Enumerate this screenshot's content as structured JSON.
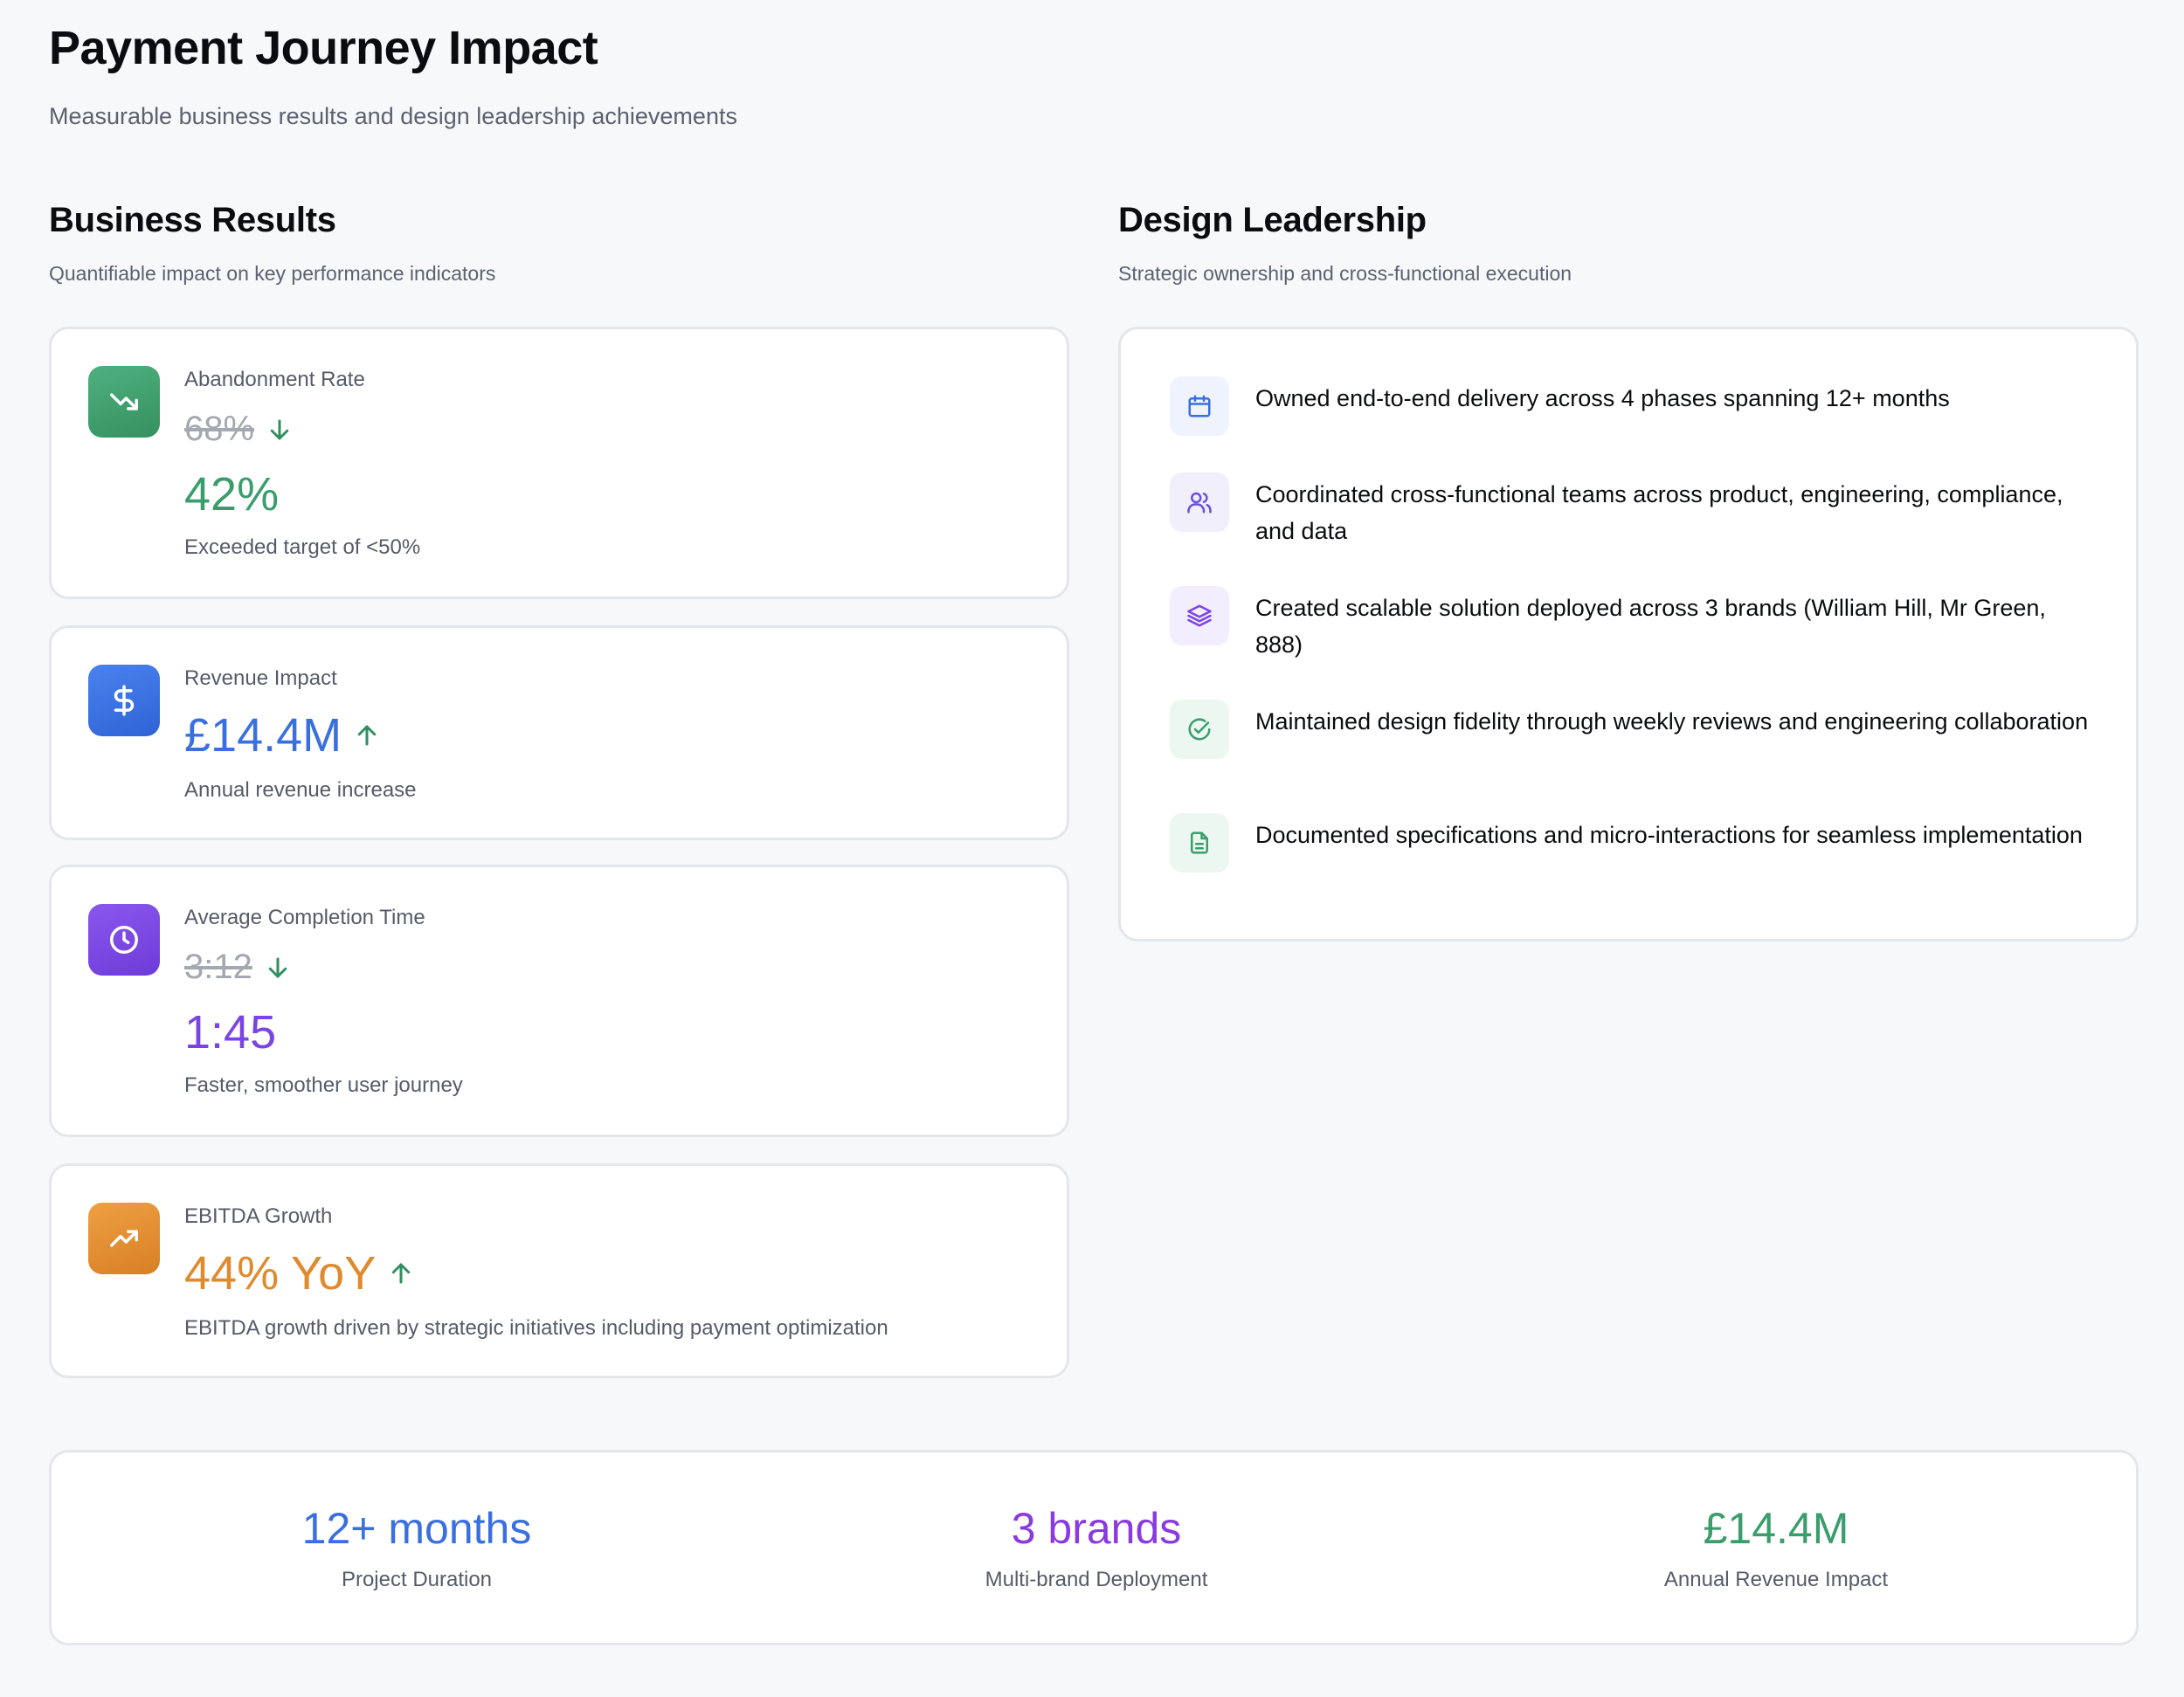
{
  "header": {
    "title": "Payment Journey Impact",
    "subtitle": "Measurable business results and design leadership achievements"
  },
  "business": {
    "title": "Business Results",
    "subtitle": "Quantifiable impact on key performance indicators",
    "metrics": [
      {
        "label": "Abandonment Rate",
        "old": "68%",
        "value": "42%",
        "desc": "Exceeded target of <50%",
        "color": "#3a9d6b",
        "icon": "trending-down-icon",
        "direction": "down"
      },
      {
        "label": "Revenue Impact",
        "value": "£14.4M",
        "desc": "Annual revenue increase",
        "color": "#3a6fe0",
        "icon": "dollar-icon",
        "direction": "up"
      },
      {
        "label": "Average Completion Time",
        "old": "3:12",
        "value": "1:45",
        "desc": "Faster, smoother user journey",
        "color": "#7a44e4",
        "icon": "clock-icon",
        "direction": "down"
      },
      {
        "label": "EBITDA Growth",
        "value": "44% YoY",
        "desc": "EBITDA growth driven by strategic initiatives including payment optimization",
        "color": "#e08a2e",
        "icon": "trending-up-icon",
        "direction": "up"
      }
    ]
  },
  "leadership": {
    "title": "Design Leadership",
    "subtitle": "Strategic ownership and cross-functional execution",
    "items": [
      {
        "text": "Owned end-to-end delivery across 4 phases spanning 12+ months",
        "icon": "calendar-icon",
        "color": "#3a6fe0"
      },
      {
        "text": "Coordinated cross-functional teams across product, engineering, compliance, and data",
        "icon": "users-icon",
        "color": "#6a4fd8"
      },
      {
        "text": "Created scalable solution deployed across 3 brands (William Hill, Mr Green, 888)",
        "icon": "layers-icon",
        "color": "#7a44e4"
      },
      {
        "text": "Maintained design fidelity through weekly reviews and engineering collaboration",
        "icon": "check-circle-icon",
        "color": "#3a9d6b"
      },
      {
        "text": "Documented specifications and micro-interactions for seamless implementation",
        "icon": "document-icon",
        "color": "#3a9d6b"
      }
    ]
  },
  "summary": [
    {
      "value": "12+ months",
      "label": "Project Duration",
      "color": "#3a6fe0"
    },
    {
      "value": "3 brands",
      "label": "Multi-brand Deployment",
      "color": "#8a3ae0"
    },
    {
      "value": "£14.4M",
      "label": "Annual Revenue Impact",
      "color": "#3a9d6b"
    }
  ],
  "colors": {
    "arrow": "#2f8f5f",
    "green": "#3a9d6b",
    "blue": "#3a6fe0",
    "purple": "#7a44e4",
    "orange": "#e08a2e"
  }
}
